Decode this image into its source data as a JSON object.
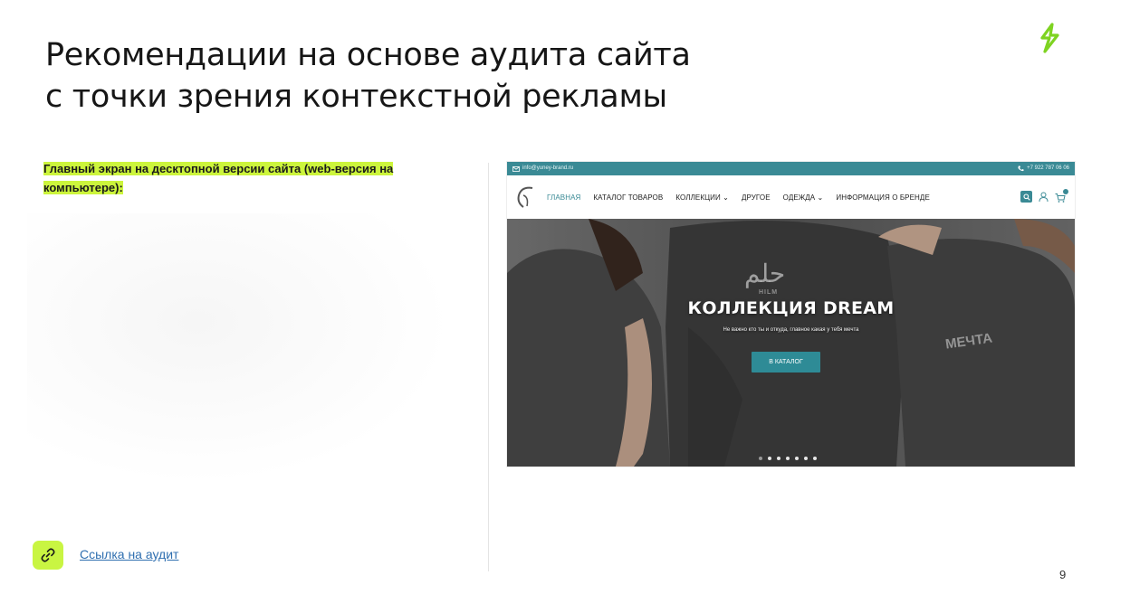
{
  "slide": {
    "title_line1": "Рекомендации на основе аудита сайта",
    "title_line2": "с точки зрения контекстной рекламы",
    "caption": "Главный экран на десктопной версии сайта (web-версия на компьютере):",
    "link_text": "Ссылка на аудит",
    "page_number": "9"
  },
  "site": {
    "topbar_email": "info@yuney-brand.ru",
    "topbar_phone": "+7 922 787 06 06",
    "nav": [
      {
        "label": "ГЛАВНАЯ",
        "active": true
      },
      {
        "label": "КАТАЛОГ ТОВАРОВ"
      },
      {
        "label": "КОЛЛЕКЦИИ ⌄"
      },
      {
        "label": "ДРУГОЕ"
      },
      {
        "label": "ОДЕЖДА ⌄"
      },
      {
        "label": "ИНФОРМАЦИЯ О БРЕНДЕ"
      }
    ],
    "hero_title": "КОЛЛЕКЦИЯ DREAM",
    "hero_subtitle": "Не важно кто ты и откуда, главное какая у тебя мечта",
    "hero_button": "В КАТАЛОГ",
    "shirt_print_left": "حلم",
    "shirt_print_left_sub": "HILM",
    "shirt_print_right": "МЕЧТА",
    "slider_dots": 7
  },
  "colors": {
    "accent_green": "#ccf53c",
    "site_teal": "#3a8a95"
  }
}
